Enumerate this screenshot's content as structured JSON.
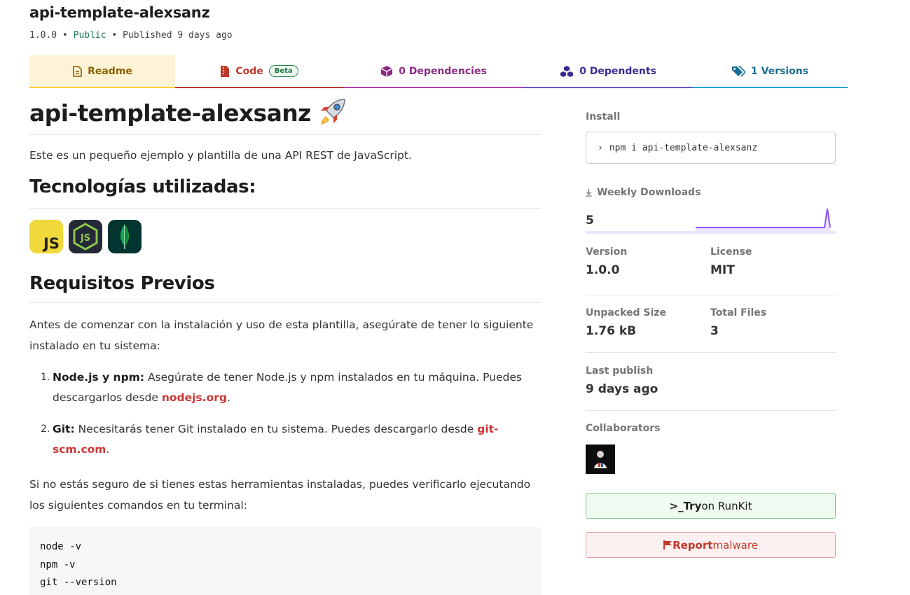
{
  "header": {
    "title": "api-template-alexsanz",
    "version": "1.0.0",
    "sep": "•",
    "visibility": "Public",
    "published": "Published 9 days ago"
  },
  "tabs": [
    {
      "label": "Readme",
      "icon": "document-icon"
    },
    {
      "label": "Code",
      "badge": "Beta",
      "icon": "file-code-icon"
    },
    {
      "label": "0 Dependencies",
      "icon": "box-icon"
    },
    {
      "label": "0 Dependents",
      "icon": "boxes-icon"
    },
    {
      "label": "1 Versions",
      "icon": "tags-icon"
    }
  ],
  "readme": {
    "title": "api-template-alexsanz",
    "title_emoji": "rocket-icon",
    "intro": "Este es un pequeño ejemplo y plantilla de una API REST de JavaScript.",
    "tech_heading": "Tecnologías utilizadas:",
    "tech_badges": [
      "JS",
      "nodejs-icon",
      "mongodb-icon"
    ],
    "req_heading": "Requisitos Previos",
    "req_intro": "Antes de comenzar con la instalación y uso de esta plantilla, asegúrate de tener lo siguiente instalado en tu sistema:",
    "requirements": [
      {
        "num": "1.",
        "name": "Node.js y npm:",
        "text": " Asegúrate de tener Node.js y npm instalados en tu máquina. Puedes descargarlos desde ",
        "link": "nodejs.org",
        "end": "."
      },
      {
        "num": "2.",
        "name": "Git:",
        "text": " Necesitarás tener Git instalado en tu sistema. Puedes descargarlo desde ",
        "link": "git-scm.com",
        "end": "."
      }
    ],
    "verify_text": "Si no estás seguro de si tienes estas herramientas instaladas, puedes verificarlo ejecutando los siguientes comandos en tu terminal:",
    "commands": [
      "node -v",
      "npm -v",
      "git --version"
    ]
  },
  "sidebar": {
    "install_label": "Install",
    "install_prompt": "›",
    "install_cmd": "npm i api-template-alexsanz",
    "downloads_label": "Weekly Downloads",
    "downloads_value": "5",
    "version_label": "Version",
    "version_value": "1.0.0",
    "license_label": "License",
    "license_value": "MIT",
    "unpacked_label": "Unpacked Size",
    "unpacked_value": "1.76 kB",
    "files_label": "Total Files",
    "files_value": "3",
    "last_publish_label": "Last publish",
    "last_publish_value": "9 days ago",
    "collaborators_label": "Collaborators",
    "runkit_prefix": ">_",
    "runkit_try": "Try",
    "runkit_rest": " on RunKit",
    "report_bold": "Report",
    "report_rest": " malware"
  },
  "colors": {
    "npm_red": "#cb3837",
    "readme_tab_bg": "#fdf3d6",
    "sparkline": "#8956ff"
  }
}
